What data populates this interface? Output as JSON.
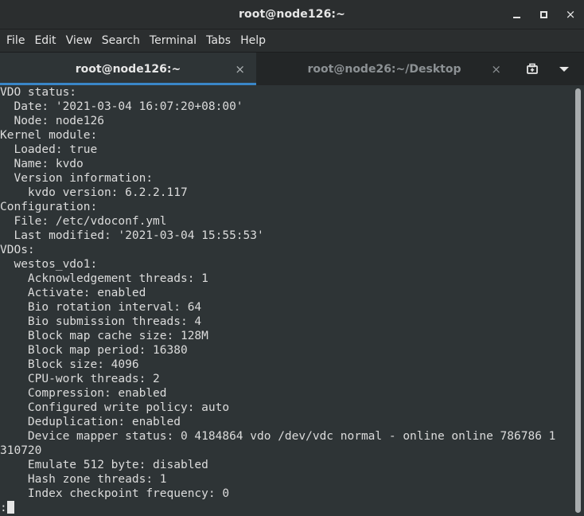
{
  "window": {
    "title": "root@node126:~",
    "controls": {
      "minimize_icon": "minimize-icon",
      "maximize_icon": "maximize-icon",
      "close_glyph": "×"
    }
  },
  "menu": [
    "File",
    "Edit",
    "View",
    "Search",
    "Terminal",
    "Tabs",
    "Help"
  ],
  "tabs": [
    {
      "label": "root@node126:~",
      "close": "×",
      "active": true
    },
    {
      "label": "root@node26:~/Desktop",
      "close": "×",
      "active": false
    }
  ],
  "tab_tools": {
    "new_tab_icon": "new-tab-icon",
    "dropdown_icon": "chevron-down-icon"
  },
  "terminal": {
    "lines": [
      "VDO status:",
      "  Date: '2021-03-04 16:07:20+08:00'",
      "  Node: node126",
      "Kernel module:",
      "  Loaded: true",
      "  Name: kvdo",
      "  Version information:",
      "    kvdo version: 6.2.2.117",
      "Configuration:",
      "  File: /etc/vdoconf.yml",
      "  Last modified: '2021-03-04 15:55:53'",
      "VDOs:",
      "  westos_vdo1:",
      "    Acknowledgement threads: 1",
      "    Activate: enabled",
      "    Bio rotation interval: 64",
      "    Bio submission threads: 4",
      "    Block map cache size: 128M",
      "    Block map period: 16380",
      "    Block size: 4096",
      "    CPU-work threads: 2",
      "    Compression: enabled",
      "    Configured write policy: auto",
      "    Deduplication: enabled",
      "    Device mapper status: 0 4184864 vdo /dev/vdc normal - online online 786786 1",
      "310720",
      "    Emulate 512 byte: disabled",
      "    Hash zone threads: 1",
      "    Index checkpoint frequency: 0"
    ],
    "prompt": ":"
  },
  "colors": {
    "terminal_bg": "#2e3436",
    "terminal_fg": "#dcdcdc",
    "accent": "#3a86c8",
    "chrome_bg": "#2b2e2f"
  }
}
